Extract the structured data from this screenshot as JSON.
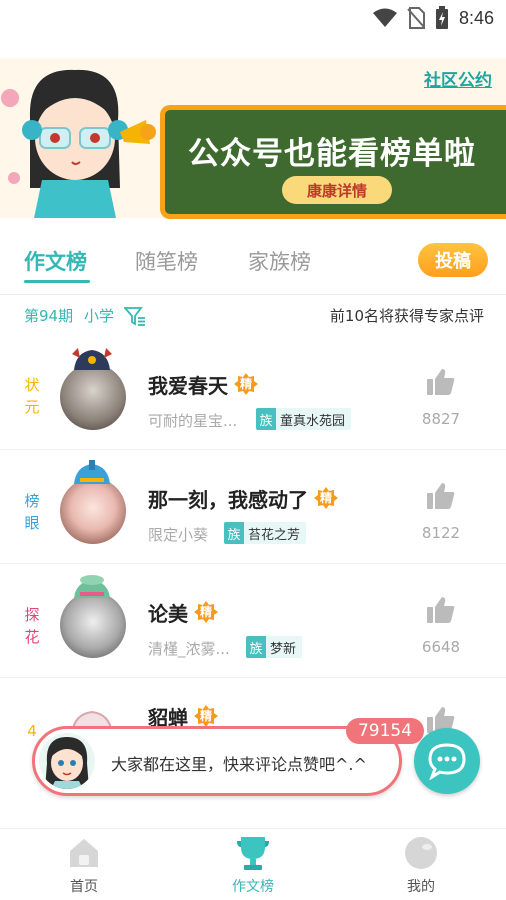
{
  "status_bar": {
    "time": "8:46"
  },
  "banner": {
    "community_link": "社区公约",
    "headline": "公众号也能看榜单啦",
    "detail_button": "康康详情"
  },
  "tabs": [
    {
      "label": "作文榜",
      "active": true
    },
    {
      "label": "随笔榜",
      "active": false
    },
    {
      "label": "家族榜",
      "active": false
    }
  ],
  "submit_button": "投稿",
  "filter": {
    "issue": "第94期",
    "level": "小学",
    "notice": "前10名将获得专家点评"
  },
  "entries": [
    {
      "rank": "状元",
      "rank_color": "#f5b400",
      "title": "我爱春天",
      "badge": "精",
      "author": "可耐的星宝...",
      "family_tag": "族",
      "family": "童真水苑园",
      "likes": "8827",
      "crown_color": "#2e3a5c"
    },
    {
      "rank": "榜眼",
      "rank_color": "#3aa0d8",
      "title": "那一刻，我感动了",
      "badge": "精",
      "author": "限定小葵",
      "family_tag": "族",
      "family": "苔花之芳",
      "likes": "8122",
      "crown_color": "#3aa0d8"
    },
    {
      "rank": "探花",
      "rank_color": "#e0457b",
      "title": "论美",
      "badge": "精",
      "author": "清槿_浓雾...",
      "family_tag": "族",
      "family": "梦新",
      "likes": "6648",
      "crown_color": "#6fbf9a"
    },
    {
      "rank": "4",
      "rank_color": "#f5b400",
      "title": "貂蝉",
      "badge": "精",
      "author": "",
      "family_tag": "",
      "family": "",
      "likes": "",
      "crown_color": ""
    }
  ],
  "toast": {
    "message": "大家都在这里，快来评论点赞吧^.^",
    "count": "79154"
  },
  "bottom_nav": [
    {
      "label": "首页",
      "icon": "home-icon",
      "active": false
    },
    {
      "label": "作文榜",
      "icon": "trophy-icon",
      "active": true
    },
    {
      "label": "我的",
      "icon": "profile-icon",
      "active": false
    }
  ],
  "colors": {
    "accent": "#34b8b4",
    "orange": "#ff9f1c",
    "toast_border": "#f0747a"
  }
}
